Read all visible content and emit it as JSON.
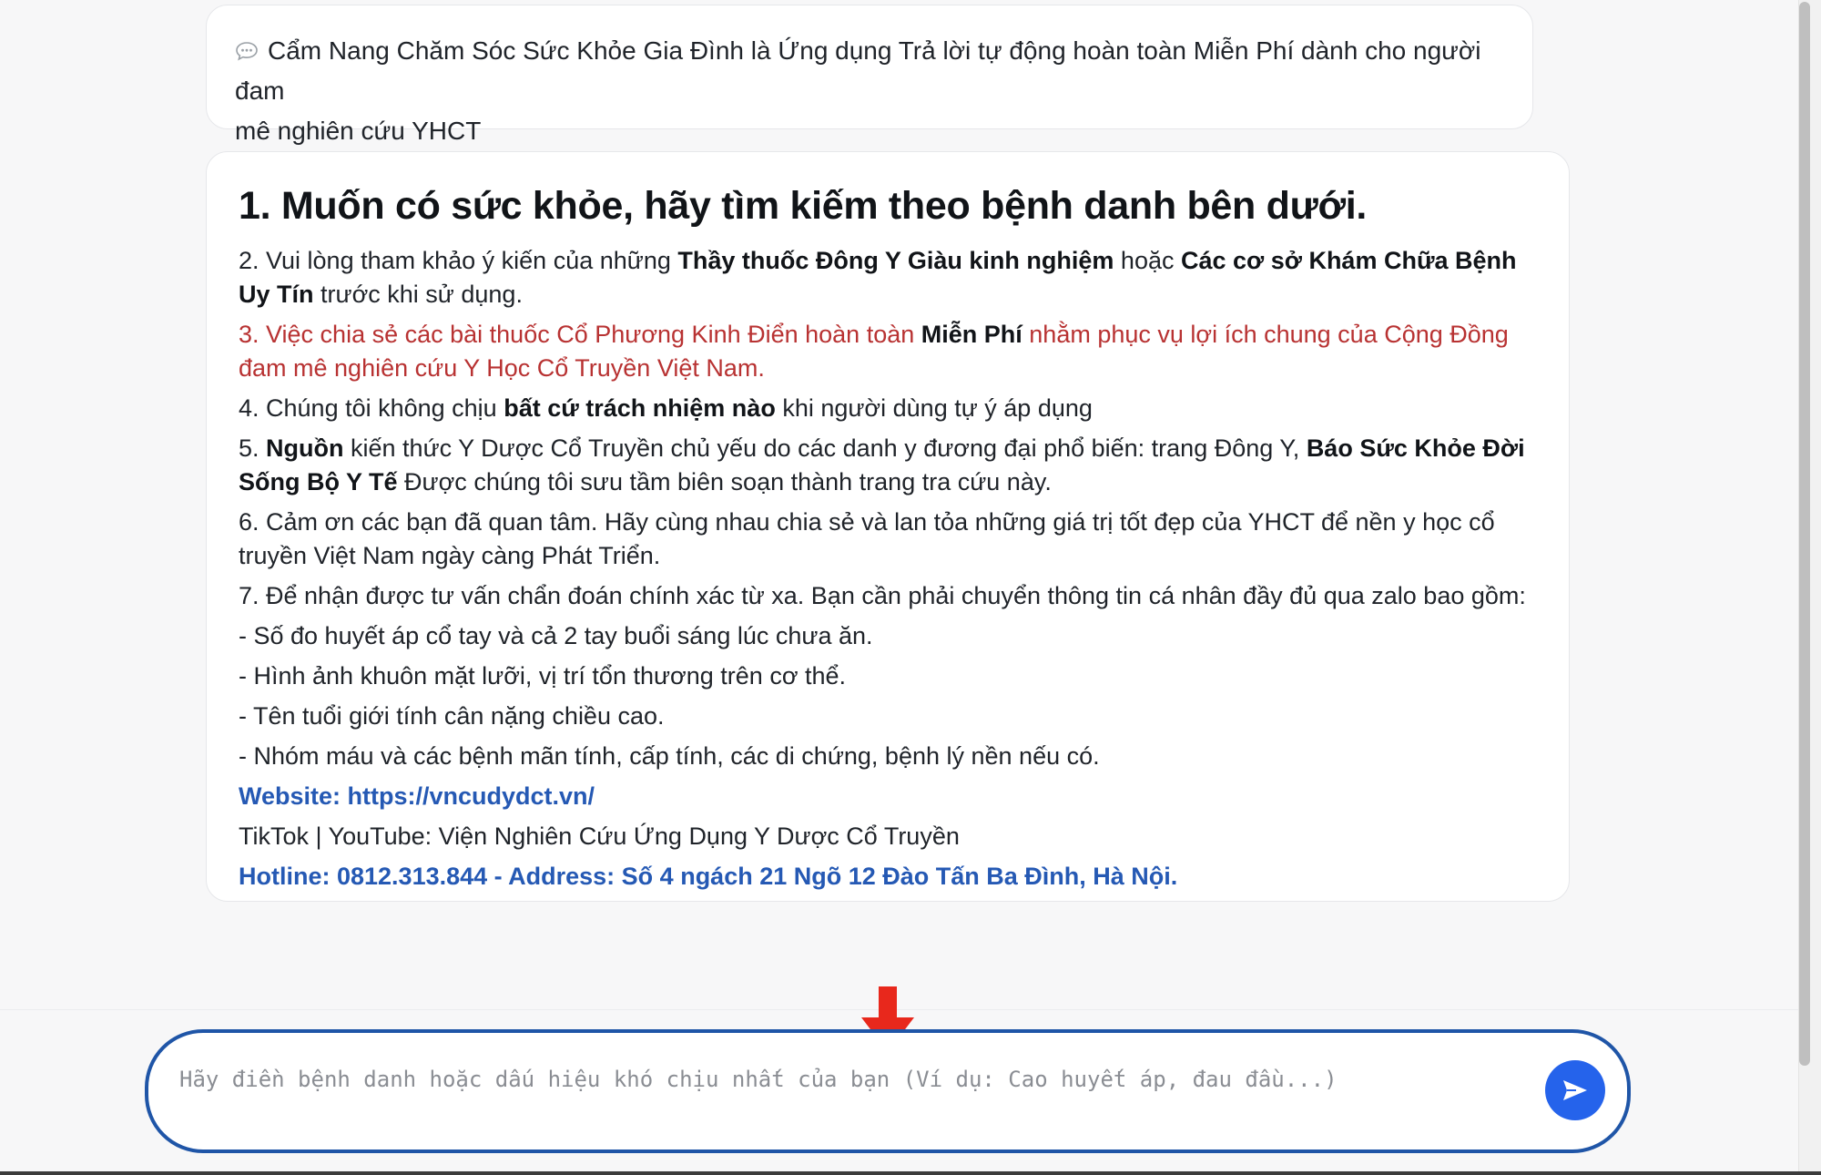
{
  "intro": {
    "line1": "Cẩm Nang Chăm Sóc Sức Khỏe Gia Đình là Ứng dụng Trả lời tự động hoàn toàn Miễn Phí dành cho người đam",
    "line2": "mê nghiên cứu YHCT"
  },
  "card": {
    "heading": "1. Muốn có sức khỏe, hãy tìm kiếm theo bệnh danh bên dưới.",
    "item2": {
      "a": "2. Vui lòng tham khảo ý kiến của những ",
      "b": "Thầy thuốc Đông Y Giàu kinh nghiệm",
      "c": " hoặc ",
      "d": "Các cơ sở Khám Chữa Bệnh Uy Tín",
      "e": " trước khi sử dụng."
    },
    "item3": {
      "a": "3. Việc chia sẻ các bài thuốc Cổ Phương Kinh Điển hoàn toàn ",
      "b": "Miễn Phí",
      "c": " nhằm phục vụ lợi ích chung của Cộng Đồng đam mê nghiên cứu Y Học Cổ Truyền Việt Nam."
    },
    "item4": {
      "a": "4. Chúng tôi không chịu ",
      "b": "bất cứ trách nhiệm nào",
      "c": " khi người dùng tự ý áp dụng"
    },
    "item5": {
      "a": "5. ",
      "b": "Nguồn",
      "c": " kiến thức Y Dược Cổ Truyền chủ yếu do các danh y đương đại phổ biến: trang Đông Y, ",
      "d": "Báo Sức Khỏe Đời Sống Bộ Y Tế",
      "e": " Được chúng tôi sưu tầm biên soạn thành trang tra cứu này."
    },
    "item6": "6. Cảm ơn các bạn đã quan tâm. Hãy cùng nhau chia sẻ và lan tỏa những giá trị tốt đẹp của YHCT để nền y học cổ truyền Việt Nam ngày càng Phát Triển.",
    "item7": "7. Để nhận được tư vấn chẩn đoán chính xác từ xa. Bạn cần phải chuyển thông tin cá nhân đầy đủ qua zalo bao gồm:",
    "bullets": [
      "- Số đo huyết áp cổ tay và cả 2 tay buổi sáng lúc chưa ăn.",
      "- Hình ảnh khuôn mặt lưỡi, vị trí tổn thương trên cơ thể.",
      "- Tên tuổi giới tính cân nặng chiều cao.",
      "- Nhóm máu và các bệnh mãn tính, cấp tính, các di chứng, bệnh lý nền nếu có."
    ],
    "website": "Website: https://vncudydct.vn/",
    "social": "TikTok | YouTube: Viện Nghiên Cứu Ứng Dụng Y Dược Cổ Truyền",
    "hotline": "Hotline: 0812.313.844 - Address: Số 4 ngách 21 Ngõ 12 Đào Tấn Ba Đình, Hà Nội."
  },
  "input": {
    "placeholder": "Hãy điền bệnh danh hoặc dấu hiệu khó chịu nhất của bạn (Ví dụ: Cao huyết áp, đau đầu...)",
    "value": ""
  },
  "icons": {
    "intro": "speech-bubble-icon",
    "send": "send-arrow-icon",
    "pointer": "red-down-arrow-icon"
  },
  "colors": {
    "accent_blue": "#2563eb",
    "input_border": "#1f55a7",
    "red_text": "#b83232",
    "link_blue": "#2559b4",
    "pointer_red": "#e8281c"
  }
}
